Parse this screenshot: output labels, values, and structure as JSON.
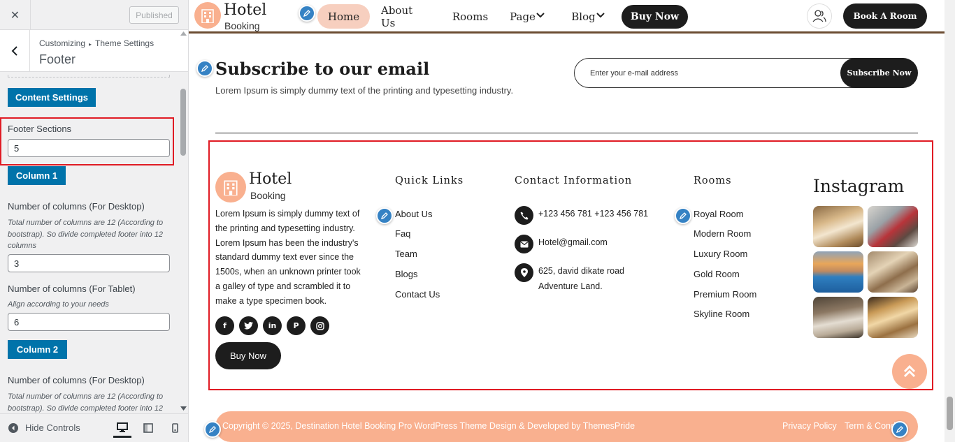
{
  "sidebar": {
    "published_label": "Published",
    "breadcrumb_parent": "Customizing",
    "breadcrumb_child": "Theme Settings",
    "section_title": "Footer",
    "content_settings_label": "Content Settings",
    "footer_sections_label": "Footer Sections",
    "footer_sections_value": "5",
    "column1_label": "Column 1",
    "col1_desktop_label": "Number of columns (For Desktop)",
    "col1_desktop_desc": "Total number of columns are 12 (According to bootstrap). So divide completed footer into 12 columns",
    "col1_desktop_value": "3",
    "col1_tablet_label": "Number of columns (For Tablet)",
    "col1_tablet_desc": "Align according to your needs",
    "col1_tablet_value": "6",
    "column2_label": "Column 2",
    "col2_desktop_label": "Number of columns (For Desktop)",
    "col2_desktop_desc": "Total number of columns are 12 (According to bootstrap). So divide completed footer into 12",
    "hide_controls_label": "Hide Controls"
  },
  "nav": {
    "logo_title": "Hotel",
    "logo_subtitle": "Booking",
    "items": [
      "Home",
      "About Us",
      "Rooms",
      "Page",
      "Blog"
    ],
    "buy_now": "Buy Now",
    "book_room": "Book A Room"
  },
  "subscribe": {
    "title": "Subscribe to our email",
    "text": "Lorem Ipsum is simply dummy text of the printing and typesetting industry.",
    "placeholder": "Enter your e-mail address",
    "button": "Subscribe Now"
  },
  "footer": {
    "logo_title": "Hotel",
    "logo_subtitle": "Booking",
    "about": "Lorem Ipsum is simply dummy text of the printing and typesetting industry. Lorem Ipsum has been the industry's standard dummy text ever since the 1500s, when an unknown printer took a galley of type and scrambled it to make a type specimen book.",
    "social": [
      "facebook-icon",
      "twitter-icon",
      "linkedin-icon",
      "pinterest-icon",
      "instagram-icon"
    ],
    "buy_now": "Buy Now",
    "quick_links_title": "Quick Links",
    "quick_links": [
      "About Us",
      "Faq",
      "Team",
      "Blogs",
      "Contact Us"
    ],
    "contact_title": "Contact Information",
    "phone": "+123 456 781 +123 456 781",
    "email": "Hotel@gmail.com",
    "address_line1": "625, david dikate road",
    "address_line2": "Adventure Land.",
    "rooms_title": "Rooms",
    "rooms": [
      "Royal Room",
      "Modern Room",
      "Luxury Room",
      "Gold Room",
      "Premium Room",
      "Skyline Room"
    ],
    "instagram_title": "Instagram",
    "copyright": "Copyright © 2025, Destination Hotel Booking Pro WordPress Theme Design & Developed by ThemesPride",
    "privacy": "Privacy Policy",
    "terms": "Term & Cond"
  },
  "colors": {
    "accent": "#f9b08f",
    "wp_blue": "#0073aa",
    "highlight_red": "#e01b24",
    "dark": "#1d1d1d"
  }
}
